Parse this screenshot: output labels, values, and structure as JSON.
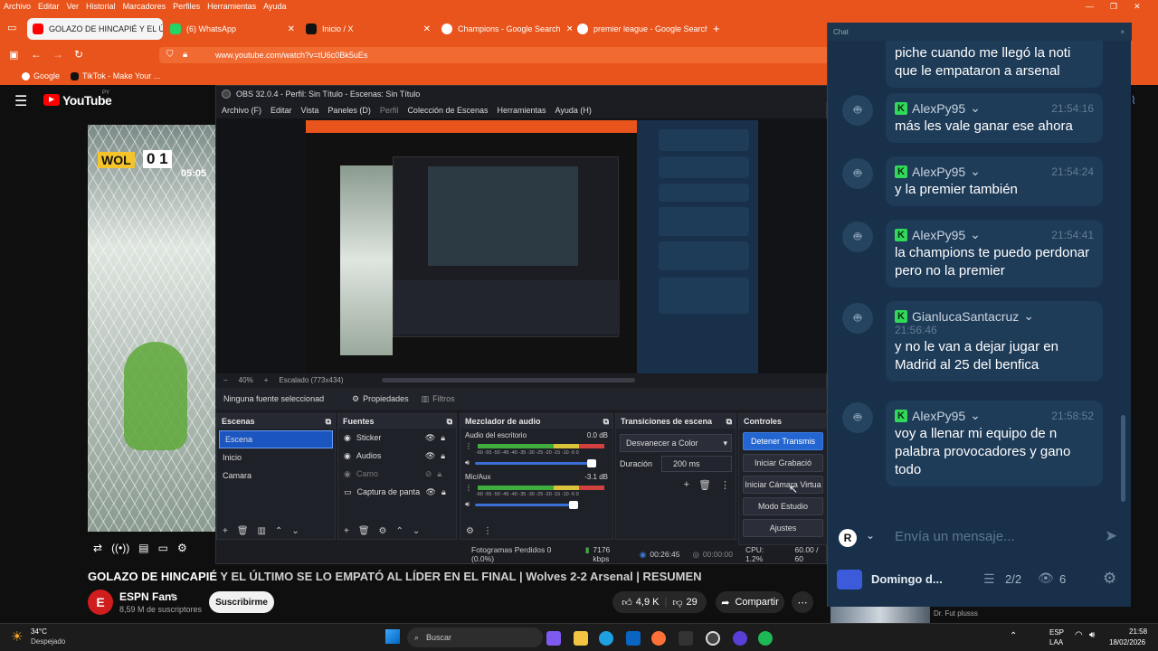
{
  "browser": {
    "menu": [
      "Archivo",
      "Editar",
      "Ver",
      "Historial",
      "Marcadores",
      "Perfiles",
      "Herramientas",
      "Ayuda"
    ],
    "tabs": [
      {
        "label": "GOLAZO DE HINCAPIÉ Y EL ÚLTI",
        "color": "#ff0000",
        "active": true
      },
      {
        "label": "(6) WhatsApp",
        "color": "#25d366",
        "active": false
      },
      {
        "label": "Inicio / X",
        "color": "#111111",
        "active": false
      },
      {
        "label": "Champions - Google Search",
        "color": "#ffffff",
        "active": false
      },
      {
        "label": "premier league - Google Search",
        "color": "#ffffff",
        "active": false
      }
    ],
    "url": "www.youtube.com/watch?v=tU6c0Bk5uEs",
    "bookmarks": [
      "Google",
      "TikTok - Make Your ..."
    ]
  },
  "youtube": {
    "logo": "YouTube",
    "logo_region": "PY",
    "score_team": "WOL",
    "score_value": "0 1",
    "score_time": "05:05",
    "video_title_bright": "GOLAZO DE HINCAPIÉ",
    "video_title_rest": " Y EL ÚLTIMO SE LO EMPATÓ AL LÍDER EN EL FINAL | Wolves 2-2 Arsenal | RESUMEN",
    "channel_name": "ESPN Fans",
    "subscribers": "8,59 M de suscriptores",
    "subscribe_label": "Suscribirme",
    "likes": "4,9 K",
    "dislikes": "29",
    "share_label": "Compartir"
  },
  "obs": {
    "title": "OBS 32.0.4 - Perfil: Sin Título - Escenas: Sin Título",
    "menu": [
      "Archivo (F)",
      "Editar",
      "Vista",
      "Paneles (D)",
      "Perfil",
      "Colección de Escenas",
      "Herramientas",
      "Ayuda (H)"
    ],
    "zoom": "40%",
    "scale": "Escalado (773x434)",
    "no_source": "Ninguna fuente seleccionad",
    "properties_label": "Propiedades",
    "filters_label": "Filtros",
    "scenes_header": "Escenas",
    "scenes": [
      "Escena",
      "Inicio",
      "Camara"
    ],
    "sources_header": "Fuentes",
    "sources": [
      "Sticker",
      "Audios",
      "Camo",
      "Captura de panta"
    ],
    "mixer_header": "Mezclador de audio",
    "mixer": [
      {
        "name": "Audio del escritorio",
        "db": "0.0 dB"
      },
      {
        "name": "Mic/Aux",
        "db": "-3.1 dB"
      }
    ],
    "meter_scale": "-60 -55 -50 -45 -40 -35 -30 -25 -20 -15 -10 -5 0",
    "transitions_header": "Transiciones de escena",
    "transition": "Desvanecer a Color",
    "duration_label": "Duración",
    "duration": "200 ms",
    "controls_header": "Controles",
    "controls": [
      "Detener Transmis",
      "Iniciar Grabació",
      "Iniciar Cámara Virtua",
      "Modo Estudio",
      "Ajustes"
    ],
    "status": {
      "frames": "Fotogramas Perdidos 0 (0.0%)",
      "kbps": "7176 kbps",
      "live_time": "00:26:45",
      "rec_time": "00:00:00",
      "cpu": "CPU: 1.2%",
      "fps": "60.00 / 60"
    }
  },
  "chat": {
    "header": "Chat",
    "first_text": "piche cuando me llegó la noti que le empataron a arsenal",
    "messages": [
      {
        "user": "AlexPy95",
        "time": "21:54:16",
        "text": "más les vale ganar ese ahora"
      },
      {
        "user": "AlexPy95",
        "time": "21:54:24",
        "text": "y la premier también"
      },
      {
        "user": "AlexPy95",
        "time": "21:54:41",
        "text": "la champions te puedo perdonar pero no la premier"
      },
      {
        "user": "GianlucaSantacruz",
        "time": "21:56:46",
        "text": "y no le van a dejar jugar en Madrid al 25 del benfica"
      },
      {
        "user": "AlexPy95",
        "time": "21:58:52",
        "text": "voy a llenar mi equipo de n palabra provocadores y gano todo"
      }
    ],
    "input_placeholder": "Envía un mensaje...",
    "input_avatar": "R",
    "footer_user": "Domingo d...",
    "footer_count": "2/2",
    "footer_viewers": "6",
    "under_text": "Dr. Fut plusss"
  },
  "taskbar": {
    "weather_temp": "34°C",
    "weather_desc": "Despejado",
    "search_label": "Buscar",
    "lang": "ESP",
    "lang2": "LAA",
    "time": "21:58",
    "date": "18/02/2026"
  }
}
